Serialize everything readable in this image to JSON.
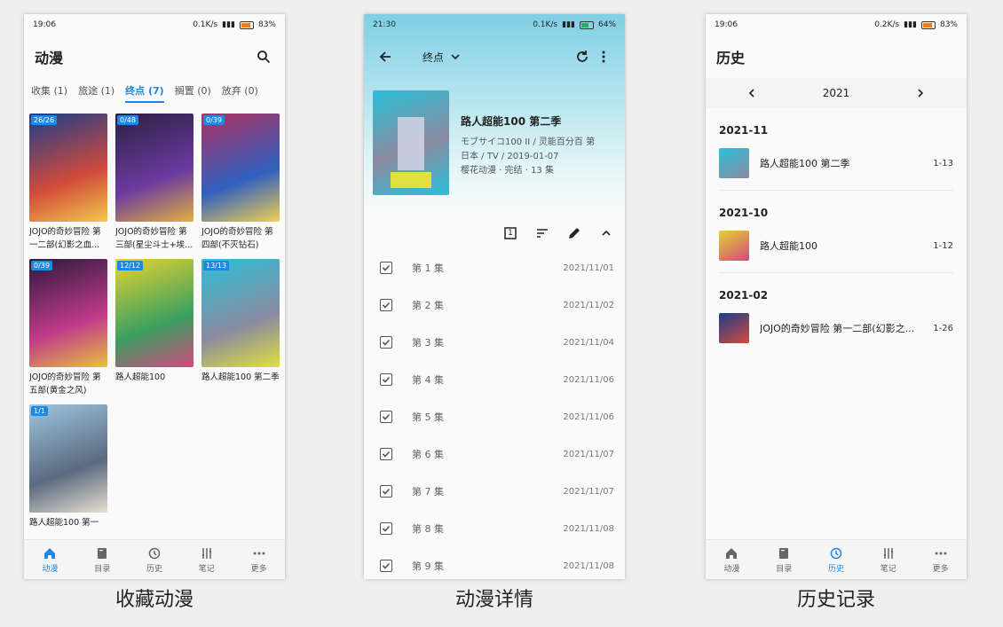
{
  "phone1": {
    "status": {
      "time": "19:06",
      "net": "0.1K/s",
      "battery": "83%"
    },
    "title": "动漫",
    "tabs": [
      {
        "label": "收集 (1)"
      },
      {
        "label": "旅途 (1)"
      },
      {
        "label": "终点 (7)",
        "active": true
      },
      {
        "label": "搁置 (0)"
      },
      {
        "label": "放弃 (0)"
      }
    ],
    "cards": [
      {
        "badge": "26/26",
        "name": "JOJO的奇妙冒险 第一二部(幻影之血...",
        "colors": [
          "#1c3c8c",
          "#d24b3a",
          "#f2c94c"
        ]
      },
      {
        "badge": "0/48",
        "name": "JOJO的奇妙冒险 第三部(星尘斗士+埃...",
        "colors": [
          "#2a2040",
          "#6b3aa0",
          "#e0b040"
        ]
      },
      {
        "badge": "0/39",
        "name": "JOJO的奇妙冒险 第四部(不灭钻石)",
        "colors": [
          "#b03060",
          "#3060c0",
          "#f0d050"
        ]
      },
      {
        "badge": "0/39",
        "name": "JOJO的奇妙冒险 第五部(黄金之风)",
        "colors": [
          "#2a1a3a",
          "#c03a8a",
          "#e8c040"
        ]
      },
      {
        "badge": "12/12",
        "name": "路人超能100",
        "colors": [
          "#e6d230",
          "#3aa060",
          "#d04a80"
        ]
      },
      {
        "badge": "13/13",
        "name": "路人超能100 第二季",
        "colors": [
          "#2ac0d8",
          "#8a8aa0",
          "#e0e040"
        ]
      },
      {
        "badge": "1/1",
        "name": "路人超能100 第一",
        "colors": [
          "#9fc6e0",
          "#5a6a80",
          "#e8e0d0"
        ]
      }
    ],
    "nav": [
      {
        "label": "动漫",
        "icon": "home-icon",
        "active": true
      },
      {
        "label": "目录",
        "icon": "book-icon"
      },
      {
        "label": "历史",
        "icon": "history-icon"
      },
      {
        "label": "笔记",
        "icon": "notes-icon"
      },
      {
        "label": "更多",
        "icon": "more-icon"
      }
    ],
    "caption": "收藏动漫"
  },
  "phone2": {
    "status": {
      "time": "21:30",
      "net": "0.1K/s",
      "battery": "64%"
    },
    "dropdown": "终点",
    "title": "路人超能100 第二季",
    "alt_title": "モブサイコ100 II / 灵能百分百 第",
    "meta": "日本 / TV / 2019-01-07",
    "studio": "樱花动漫 · 完结 · 13 集",
    "episodes": [
      {
        "title": "第 1 集",
        "date": "2021/11/01"
      },
      {
        "title": "第 2 集",
        "date": "2021/11/02"
      },
      {
        "title": "第 3 集",
        "date": "2021/11/04"
      },
      {
        "title": "第 4 集",
        "date": "2021/11/06"
      },
      {
        "title": "第 5 集",
        "date": "2021/11/06"
      },
      {
        "title": "第 6 集",
        "date": "2021/11/07"
      },
      {
        "title": "第 7 集",
        "date": "2021/11/07"
      },
      {
        "title": "第 8 集",
        "date": "2021/11/08"
      },
      {
        "title": "第 9 集",
        "date": "2021/11/08"
      }
    ],
    "tool_badge": "1",
    "caption": "动漫详情"
  },
  "phone3": {
    "status": {
      "time": "19:06",
      "net": "0.2K/s",
      "battery": "83%"
    },
    "title": "历史",
    "year": "2021",
    "groups": [
      {
        "month": "2021-11",
        "items": [
          {
            "name": "路人超能100 第二季",
            "eps": "1-13",
            "colors": [
              "#2ac0d8",
              "#8a8aa0"
            ]
          }
        ]
      },
      {
        "month": "2021-10",
        "items": [
          {
            "name": "路人超能100",
            "eps": "1-12",
            "colors": [
              "#e6d230",
              "#d04a80"
            ]
          }
        ]
      },
      {
        "month": "2021-02",
        "items": [
          {
            "name": "JOJO的奇妙冒险 第一二部(幻影之...",
            "eps": "1-26",
            "colors": [
              "#1c3c8c",
              "#d24b3a"
            ]
          }
        ]
      }
    ],
    "nav": [
      {
        "label": "动漫",
        "icon": "home-icon"
      },
      {
        "label": "目录",
        "icon": "book-icon"
      },
      {
        "label": "历史",
        "icon": "history-icon",
        "active": true
      },
      {
        "label": "笔记",
        "icon": "notes-icon"
      },
      {
        "label": "更多",
        "icon": "more-icon"
      }
    ],
    "caption": "历史记录"
  },
  "colors": {
    "accent": "#1e88e5"
  }
}
